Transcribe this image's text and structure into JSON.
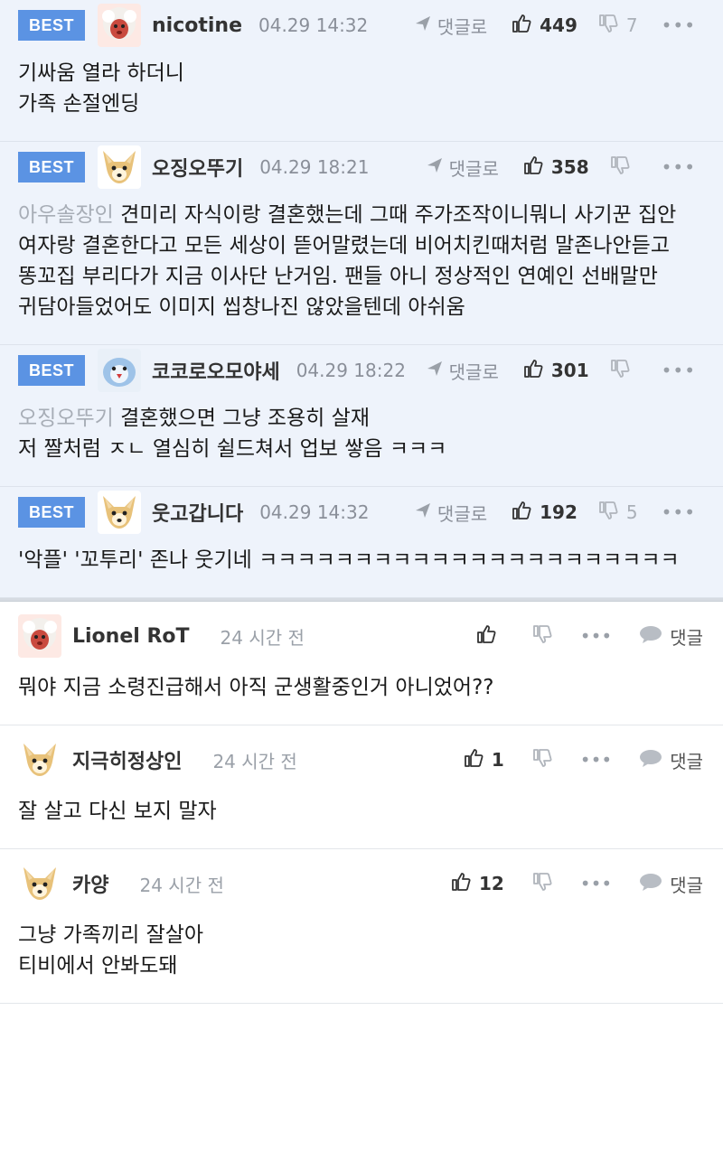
{
  "best_comments": [
    {
      "badge": "BEST",
      "avatar": "sheep-avatar",
      "nickname": "nicotine",
      "date": "04.29 14:32",
      "reply_label": "댓글로",
      "likes": "449",
      "dislikes": "7",
      "more": "•••",
      "mention": "",
      "lines": [
        "기싸움 열라 하더니",
        "가족 손절엔딩"
      ]
    },
    {
      "badge": "BEST",
      "avatar": "dog-avatar",
      "nickname": "오징오뚜기",
      "date": "04.29 18:21",
      "reply_label": "댓글로",
      "likes": "358",
      "dislikes": "",
      "more": "•••",
      "mention": "아우솔장인",
      "text": "견미리 자식이랑 결혼했는데 그때 주가조작이니뭐니 사기꾼 집안 여자랑 결혼한다고 모든 세상이 뜯어말렸는데 비어치킨때처럼 말존나안듣고 똥꼬집 부리다가 지금 이사단 난거임. 팬들 아니 정상적인 연예인 선배말만 귀담아들었어도 이미지 씹창나진 않았을텐데 아쉬움"
    },
    {
      "badge": "BEST",
      "avatar": "bird-avatar",
      "nickname": "코코로오모야세",
      "date": "04.29 18:22",
      "reply_label": "댓글로",
      "likes": "301",
      "dislikes": "",
      "more": "•••",
      "mention": "오징오뚜기",
      "text": "결혼했으면 그냥 조용히 살재",
      "text2": "저 짤처럼 ㅈㄴ 열심히 쉴드쳐서 업보 쌓음 ㅋㅋㅋ"
    },
    {
      "badge": "BEST",
      "avatar": "dog-avatar",
      "nickname": "웃고갑니다",
      "date": "04.29 14:32",
      "reply_label": "댓글로",
      "likes": "192",
      "dislikes": "5",
      "more": "•••",
      "mention": "",
      "lines": [
        "'악플' '꼬투리' 존나 웃기네 ㅋㅋㅋㅋㅋㅋㅋㅋㅋㅋㅋㅋㅋㅋㅋㅋㅋㅋㅋㅋㅋㅋ"
      ]
    }
  ],
  "comments": [
    {
      "avatar": "sheep-avatar",
      "nickname": "Lionel RoT",
      "date": "24 시간 전",
      "likes": "",
      "more": "•••",
      "reply_label": "댓글",
      "lines": [
        "뭐야 지금 소령진급해서 아직 군생활중인거 아니었어??"
      ]
    },
    {
      "avatar": "dog-avatar",
      "nickname": "지극히정상인",
      "date": "24 시간 전",
      "likes": "1",
      "more": "•••",
      "reply_label": "댓글",
      "lines": [
        "잘 살고 다신 보지 말자"
      ]
    },
    {
      "avatar": "dog-avatar",
      "nickname": "카양",
      "date": "24 시간 전",
      "likes": "12",
      "more": "•••",
      "reply_label": "댓글",
      "lines": [
        "그냥 가족끼리 잘살아",
        "티비에서 안봐도돼"
      ]
    }
  ]
}
